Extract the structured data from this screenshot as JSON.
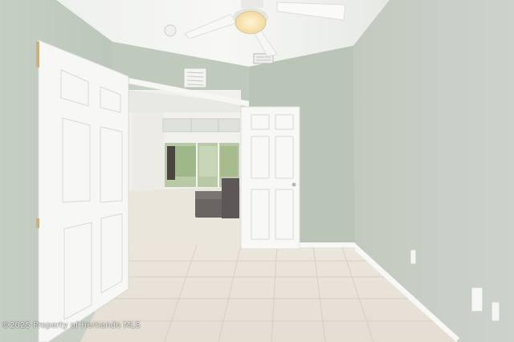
{
  "watermark": {
    "text": "©2025 Property of Hernando MLS"
  },
  "colors": {
    "wall_left": "#c3ccc1",
    "wall_back": "#bcc7bb",
    "wall_right": "#c7cec6",
    "ceiling": "#f4f5f3",
    "floor": "#e9e4db",
    "door": "#f7f7f5",
    "trim": "#f8f8f6"
  }
}
